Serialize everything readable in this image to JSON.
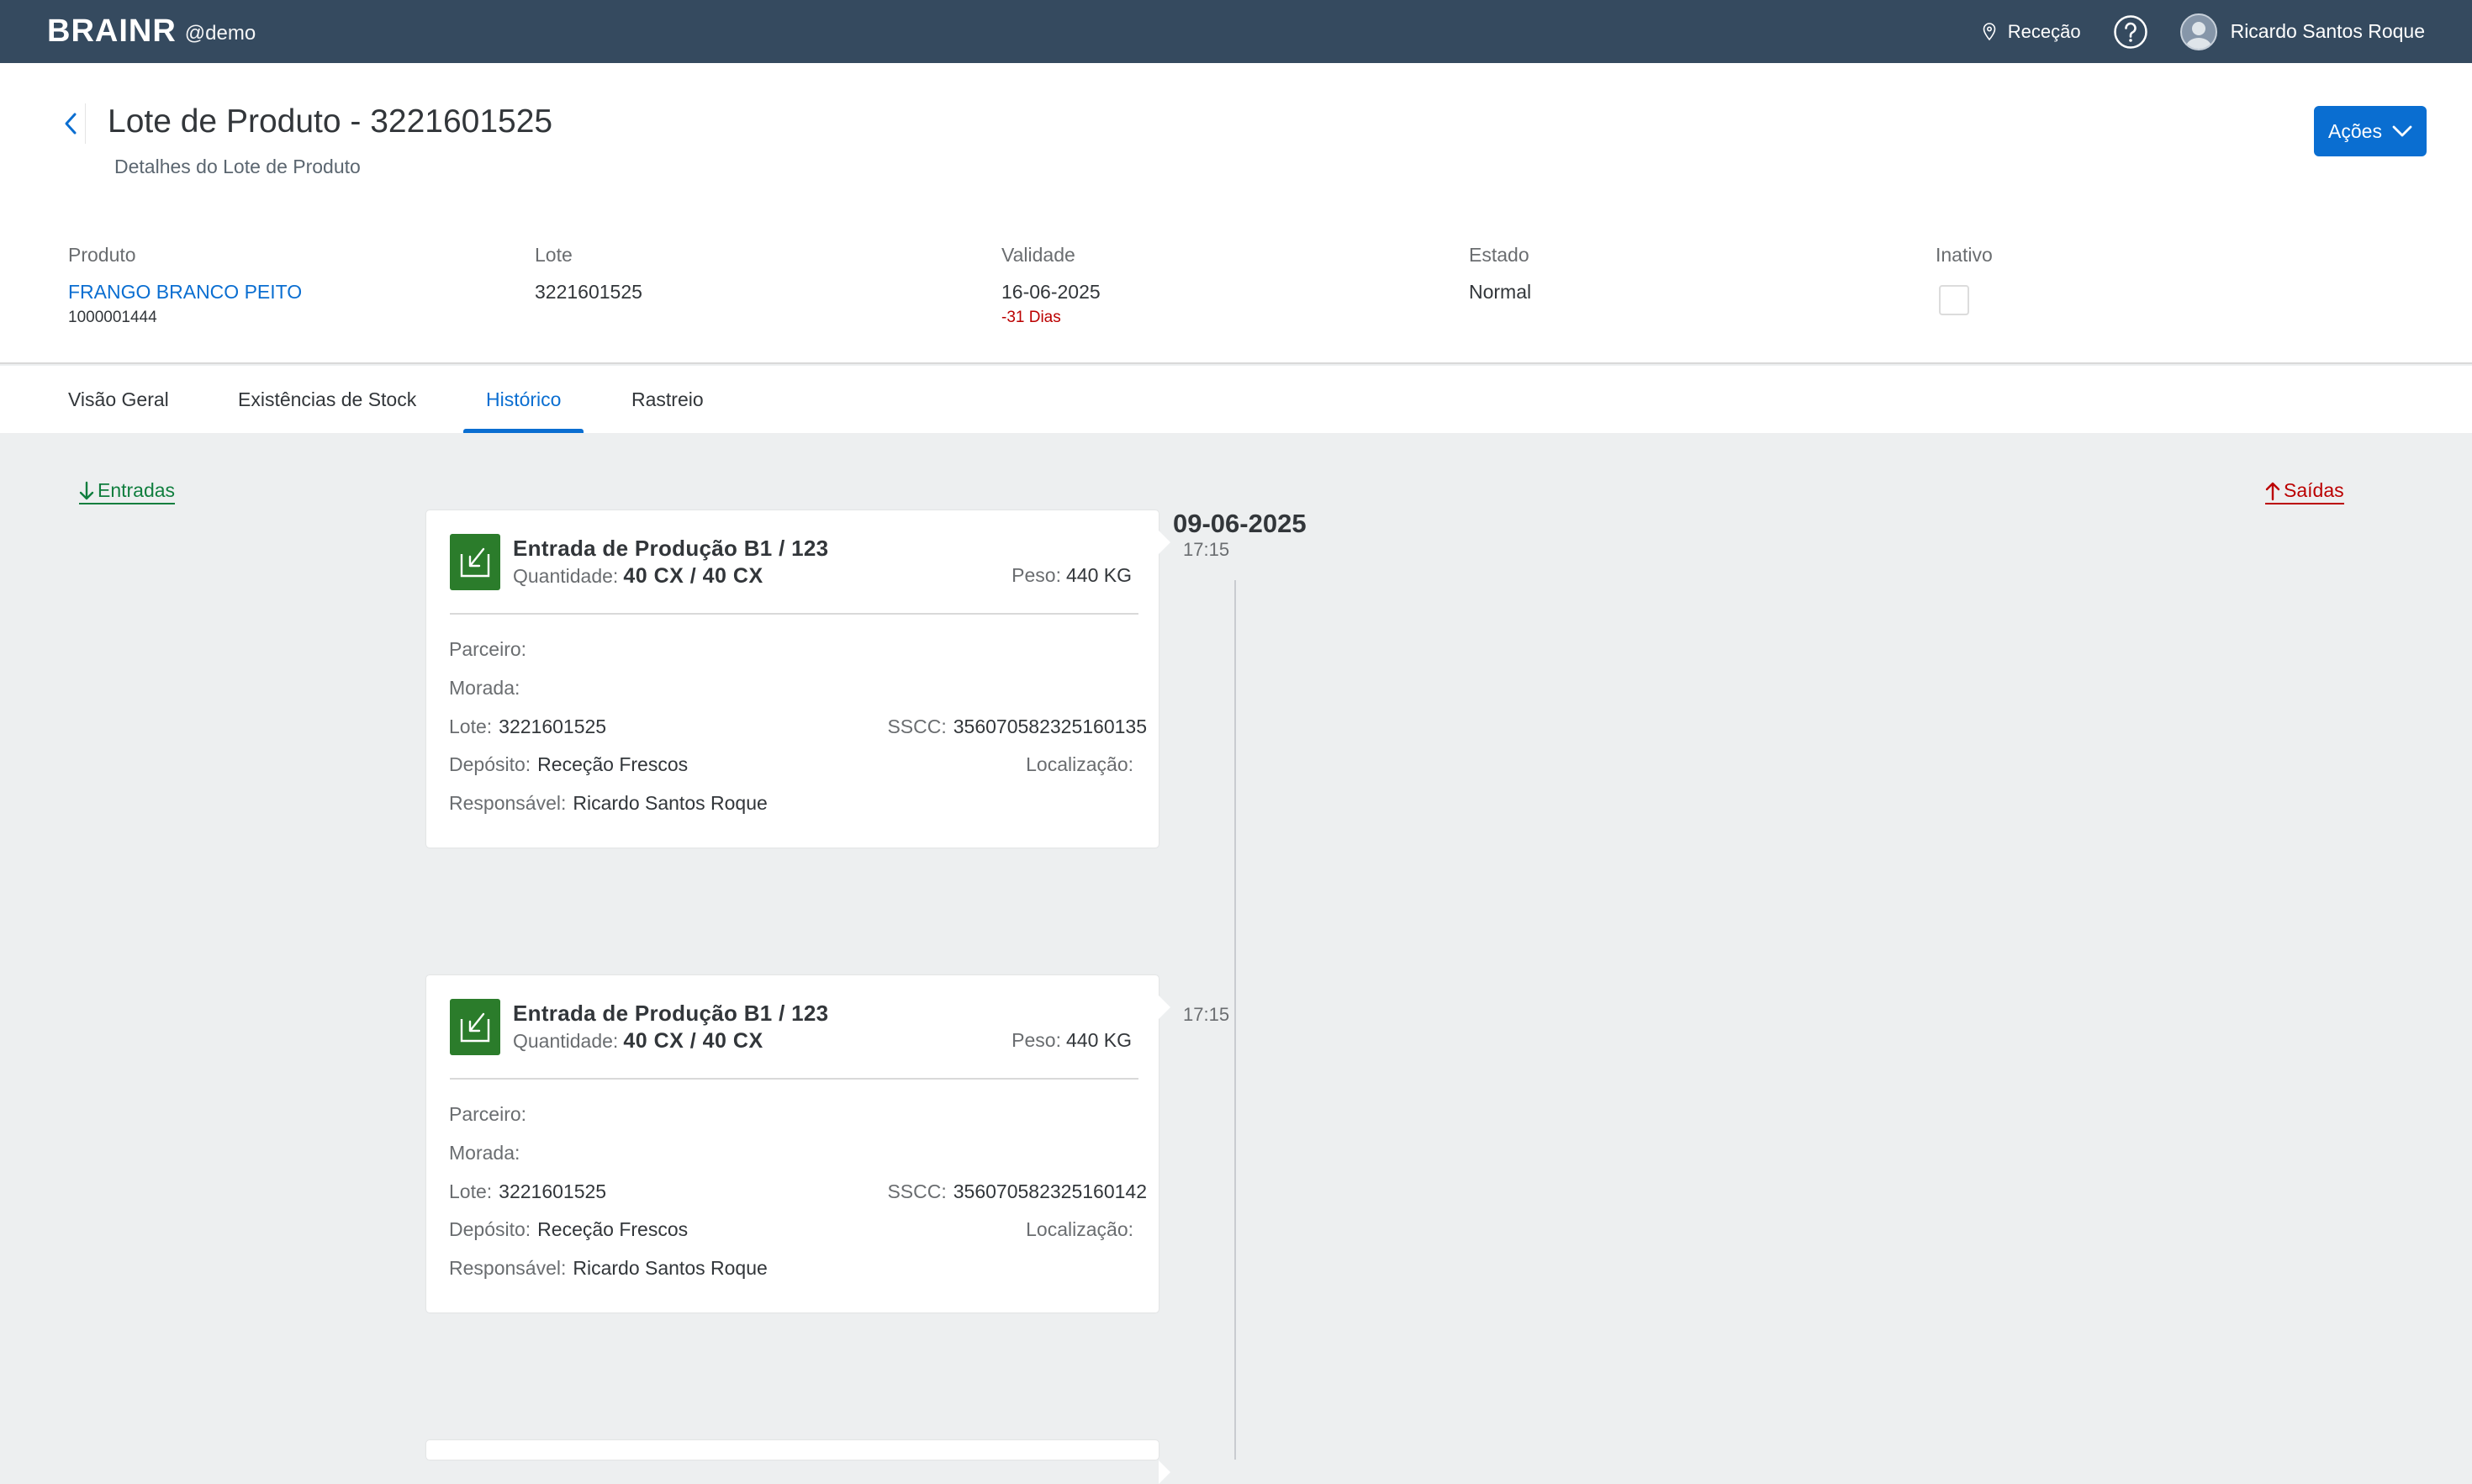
{
  "shell": {
    "logo": "BRAINR",
    "tenant": "@demo",
    "location": "Receção",
    "user_name": "Ricardo Santos Roque"
  },
  "header": {
    "title": "Lote de Produto - 3221601525",
    "subtitle": "Detalhes do Lote de Produto",
    "actions_label": "Ações"
  },
  "facets": {
    "produto": {
      "label": "Produto",
      "value": "FRANGO BRANCO PEITO",
      "sub": "1000001444"
    },
    "lote": {
      "label": "Lote",
      "value": "3221601525"
    },
    "validade": {
      "label": "Validade",
      "value": "16-06-2025",
      "sub": "-31 Dias"
    },
    "estado": {
      "label": "Estado",
      "value": "Normal"
    },
    "inativo": {
      "label": "Inativo",
      "checked": false
    }
  },
  "tabs": [
    {
      "label": "Visão Geral"
    },
    {
      "label": "Existências de Stock"
    },
    {
      "label": "Histórico",
      "active": true
    },
    {
      "label": "Rastreio"
    }
  ],
  "timeline": {
    "entradas_label": "Entradas",
    "saidas_label": "Saídas",
    "date": "09-06-2025",
    "entries": [
      {
        "time": "17:15",
        "title": "Entrada de Produção B1 / 123",
        "qty_label": "Quantidade:",
        "qty_value": "40 CX / 40 CX",
        "peso_label": "Peso:",
        "peso_value": "440 KG",
        "parceiro_label": "Parceiro:",
        "morada_label": "Morada:",
        "lote_label": "Lote:",
        "lote_value": "3221601525",
        "sscc_label": "SSCC:",
        "sscc_value": "356070582325160135",
        "deposito_label": "Depósito:",
        "deposito_value": "Receção Frescos",
        "localizacao_label": "Localização:",
        "responsavel_label": "Responsável:",
        "responsavel_value": "Ricardo Santos Roque"
      },
      {
        "time": "17:15",
        "title": "Entrada de Produção B1 / 123",
        "qty_label": "Quantidade:",
        "qty_value": "40 CX / 40 CX",
        "peso_label": "Peso:",
        "peso_value": "440 KG",
        "parceiro_label": "Parceiro:",
        "morada_label": "Morada:",
        "lote_label": "Lote:",
        "lote_value": "3221601525",
        "sscc_label": "SSCC:",
        "sscc_value": "356070582325160142",
        "deposito_label": "Depósito:",
        "deposito_value": "Receção Frescos",
        "localizacao_label": "Localização:",
        "responsavel_label": "Responsável:",
        "responsavel_value": "Ricardo Santos Roque"
      }
    ]
  },
  "colors": {
    "shell": "#354a5f",
    "accent": "#0a6ed1",
    "entrada_green": "#107e3e",
    "saida_red": "#bb0000"
  }
}
